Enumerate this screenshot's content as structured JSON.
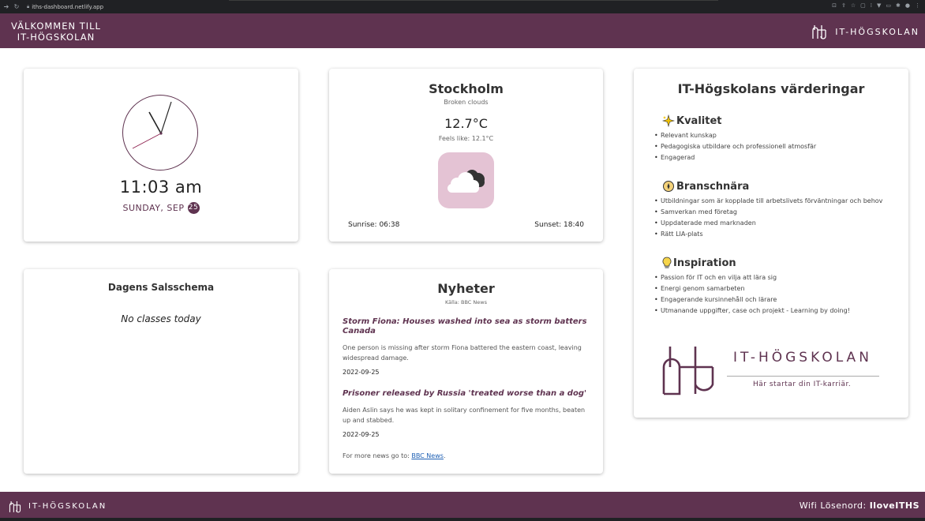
{
  "browser": {
    "url": "iths-dashboard.netlify.app",
    "back_icon": "arrow-right-icon",
    "reload_icon": "reload-icon"
  },
  "header": {
    "welcome_line1": "VÄLKOMMEN TILL",
    "welcome_line2": "IT-HÖGSKOLAN",
    "logo_text": "IT-HÖGSKOLAN"
  },
  "clock": {
    "time": "11:03 am",
    "date_text": "SUNDAY, SEP",
    "day": "25"
  },
  "weather": {
    "city": "Stockholm",
    "description": "Broken clouds",
    "temperature": "12.7°C",
    "feels_like": "Feels like: 12.1°C",
    "icon": "broken-clouds-icon",
    "sunrise": "Sunrise: 06:38",
    "sunset": "Sunset: 18:40"
  },
  "values": {
    "title": "IT-Högskolans värderingar",
    "sections": [
      {
        "heading": "Kvalitet",
        "icon": "sparkle-icon",
        "items": [
          "Relevant kunskap",
          "Pedagogiska utbildare och professionell atmosfär",
          "Engagerad"
        ]
      },
      {
        "heading": "Branschnära",
        "icon": "compass-icon",
        "items": [
          "Utbildningar som är kopplade till arbetslivets förväntningar och behov",
          "Samverkan med företag",
          "Uppdaterade med marknaden",
          "Rätt LIA-plats"
        ]
      },
      {
        "heading": "Inspiration",
        "icon": "lightbulb-icon",
        "items": [
          "Passion för IT och en vilja att lära sig",
          "Energi genom samarbeten",
          "Engagerande kursinnehåll och lärare",
          "Utmanande uppgifter, case och projekt - Learning by doing!"
        ]
      }
    ],
    "logo_text": "IT-HÖGSKOLAN",
    "tagline": "Här startar din IT-karriär."
  },
  "schedule": {
    "title": "Dagens Salsschema",
    "empty_text": "No classes today"
  },
  "news": {
    "title": "Nyheter",
    "source": "Källa: BBC News",
    "articles": [
      {
        "headline": "Storm Fiona: Houses washed into sea as storm batters Canada",
        "summary": "One person is missing after storm Fiona battered the eastern coast, leaving widespread damage.",
        "date": "2022-09-25"
      },
      {
        "headline": "Prisoner released by Russia 'treated worse than a dog'",
        "summary": "Aiden Aslin says he was kept in solitary confinement for five months, beaten up and stabbed.",
        "date": "2022-09-25"
      }
    ],
    "more_prefix": "For more news go to: ",
    "more_link": "BBC News",
    "more_suffix": "."
  },
  "footer": {
    "logo_text": "IT-HÖGSKOLAN",
    "wifi_label": "Wifi Lösenord: ",
    "wifi_password": "IloveITHS"
  },
  "colors": {
    "brand": "#5f3350",
    "weather_icon_bg": "#e4c3d4",
    "link": "#1d5fb4"
  }
}
